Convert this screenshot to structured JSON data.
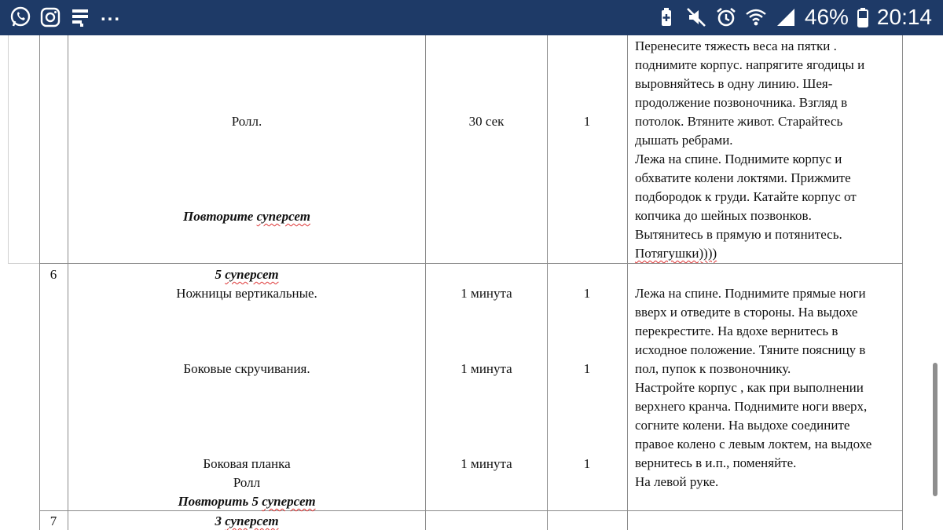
{
  "statusbar": {
    "left_icons": [
      "whatsapp-icon",
      "instagram-icon",
      "notes-icon"
    ],
    "overflow": "...",
    "right_icons": [
      "battery-saver-icon",
      "mute-icon",
      "alarm-icon",
      "wifi-icon",
      "signal-icon",
      "battery-icon"
    ],
    "battery": "46%",
    "time": "20:14"
  },
  "rows": {
    "r5": {
      "exercise": "Ролл.",
      "repeat": "Повторите",
      "repeat_word": "суперсет",
      "time": "30 сек",
      "sets": "1",
      "description": [
        "Перенесите тяжесть веса на пятки .",
        "поднимите корпус. напрягите ягодицы и",
        "выровняйтесь в одну линию. Шея-",
        "продолжение позвоночника. Взгляд в",
        "потолок. Втяните живот. Старайтесь",
        "дышать ребрами.",
        "Лежа на спине. Поднимите корпус и",
        "обхватите колени локтями. Прижмите",
        "подбородок к груди. Катайте корпус от",
        "копчика до шейных позвонков.",
        "Вытянитесь в прямую и потянитесь.",
        "Потягушки))))"
      ]
    },
    "r6": {
      "num": "6",
      "header_num": "5",
      "header_word": "суперсет",
      "ex1": "Ножницы вертикальные.",
      "ex2": "Боковые скручивания.",
      "ex3": "Боковая планка",
      "ex4": "Ролл",
      "repeat": "Повторить 5",
      "repeat_word": "суперсет",
      "time1": "1 минута",
      "time2": "1 минута",
      "time3": "1 минута",
      "sets1": "1",
      "sets2": "1",
      "sets3": "1",
      "description": [
        "Лежа на спине. Поднимите прямые ноги",
        "вверх и отведите в стороны. На выдохе",
        "перекрестите. На вдохе вернитесь  в",
        "исходное положение. Тяните поясницу в",
        "пол, пупок к позвоночнику.",
        "Настройте корпус , как при выполнении",
        "верхнего кранча. Поднимите ноги вверх,",
        "согните колени. На выдохе соедините",
        "правое колено с левым локтем, на выдохе",
        "вернитесь в и.п., поменяйте.",
        "На левой руке."
      ]
    },
    "r7": {
      "num": "7",
      "header_num": "3",
      "header_word": "суперсет"
    }
  }
}
